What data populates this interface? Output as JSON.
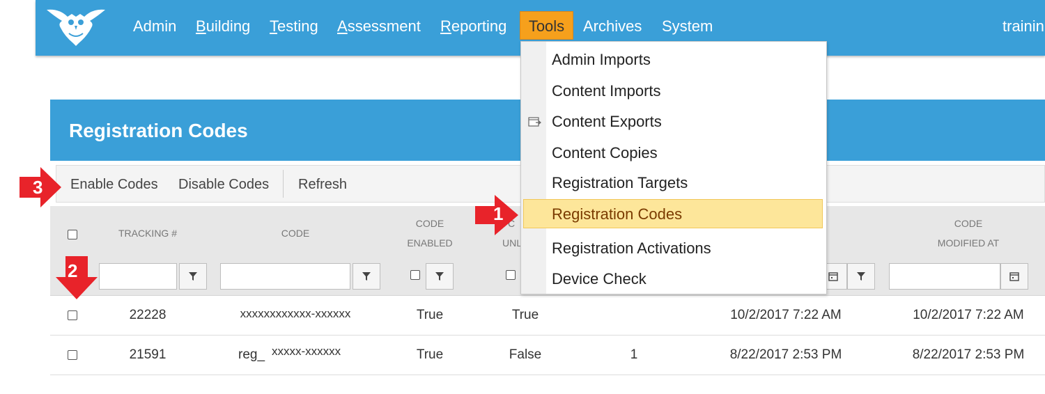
{
  "nav": {
    "items": [
      "Admin",
      "Building",
      "Testing",
      "Assessment",
      "Reporting"
    ],
    "tools": "Tools",
    "archives": "Archives",
    "system": "System",
    "user": "trainin",
    "bg_color": "#3a9fd8",
    "active_color": "#f6a01c"
  },
  "tools_menu": {
    "items": [
      "Admin Imports",
      "Content Imports",
      "Content Exports",
      "Content Copies",
      "Registration Targets",
      "Registration Codes",
      "Registration Activations",
      "Device Check"
    ],
    "selected": "Registration Codes",
    "highlight_color": "#fde69a"
  },
  "page": {
    "title": "Registration Codes"
  },
  "toolbar": {
    "enable": "Enable Codes",
    "disable": "Disable Codes",
    "refresh": "Refresh"
  },
  "grid": {
    "headers": {
      "tracking": "TRACKING #",
      "code": "CODE",
      "enabled_1": "CODE",
      "enabled_2": "ENABLED",
      "unl_1": "C",
      "unl_2": "UNL",
      "modified_1": "CODE",
      "modified_2": "MODIFIED AT"
    },
    "rows": [
      {
        "tracking": "22228",
        "code": "xxxxxxxxxxxx-xxxxxx",
        "enabled": "True",
        "unlimited": "True",
        "count": "",
        "created": "10/2/2017 7:22 AM",
        "modified": "10/2/2017 7:22 AM"
      },
      {
        "tracking": "21591",
        "code_prefix": "reg_",
        "code": "xxxxx-xxxxxx",
        "enabled": "True",
        "unlimited": "False",
        "count": "1",
        "created": "8/22/2017 2:53 PM",
        "modified": "8/22/2017 2:53 PM"
      }
    ]
  },
  "annotations": {
    "steps": [
      "1",
      "2",
      "3"
    ],
    "arrow_color": "#e8232a"
  }
}
